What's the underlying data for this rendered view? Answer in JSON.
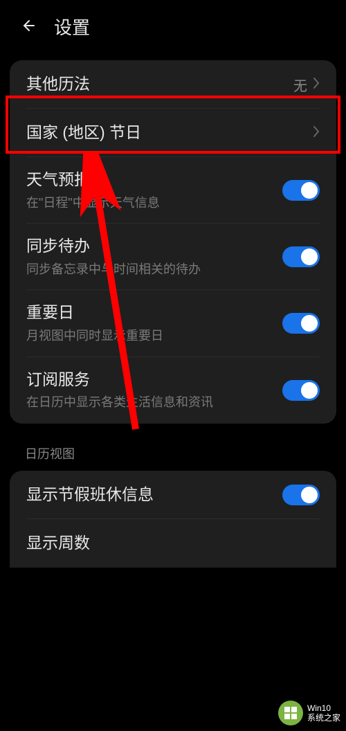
{
  "header": {
    "title": "设置"
  },
  "settings_group1": {
    "other_cal": {
      "title": "其他历法",
      "value": "无"
    },
    "holidays": {
      "title": "国家 (地区) 节日"
    },
    "weather": {
      "title": "天气预报",
      "sub": "在\"日程\"中显示天气信息"
    },
    "sync_todo": {
      "title": "同步待办",
      "sub": "同步备忘录中与时间相关的待办"
    },
    "important": {
      "title": "重要日",
      "sub": "月视图中同时显示重要日"
    },
    "subscribe": {
      "title": "订阅服务",
      "sub": "在日历中显示各类生活信息和资讯"
    }
  },
  "section2_label": "日历视图",
  "settings_group2": {
    "show_holiday_info": {
      "title": "显示节假班休信息"
    },
    "show_week_num": {
      "title": "显示周数"
    }
  },
  "watermark": {
    "line1": "Win10",
    "line2": "系统之家"
  }
}
